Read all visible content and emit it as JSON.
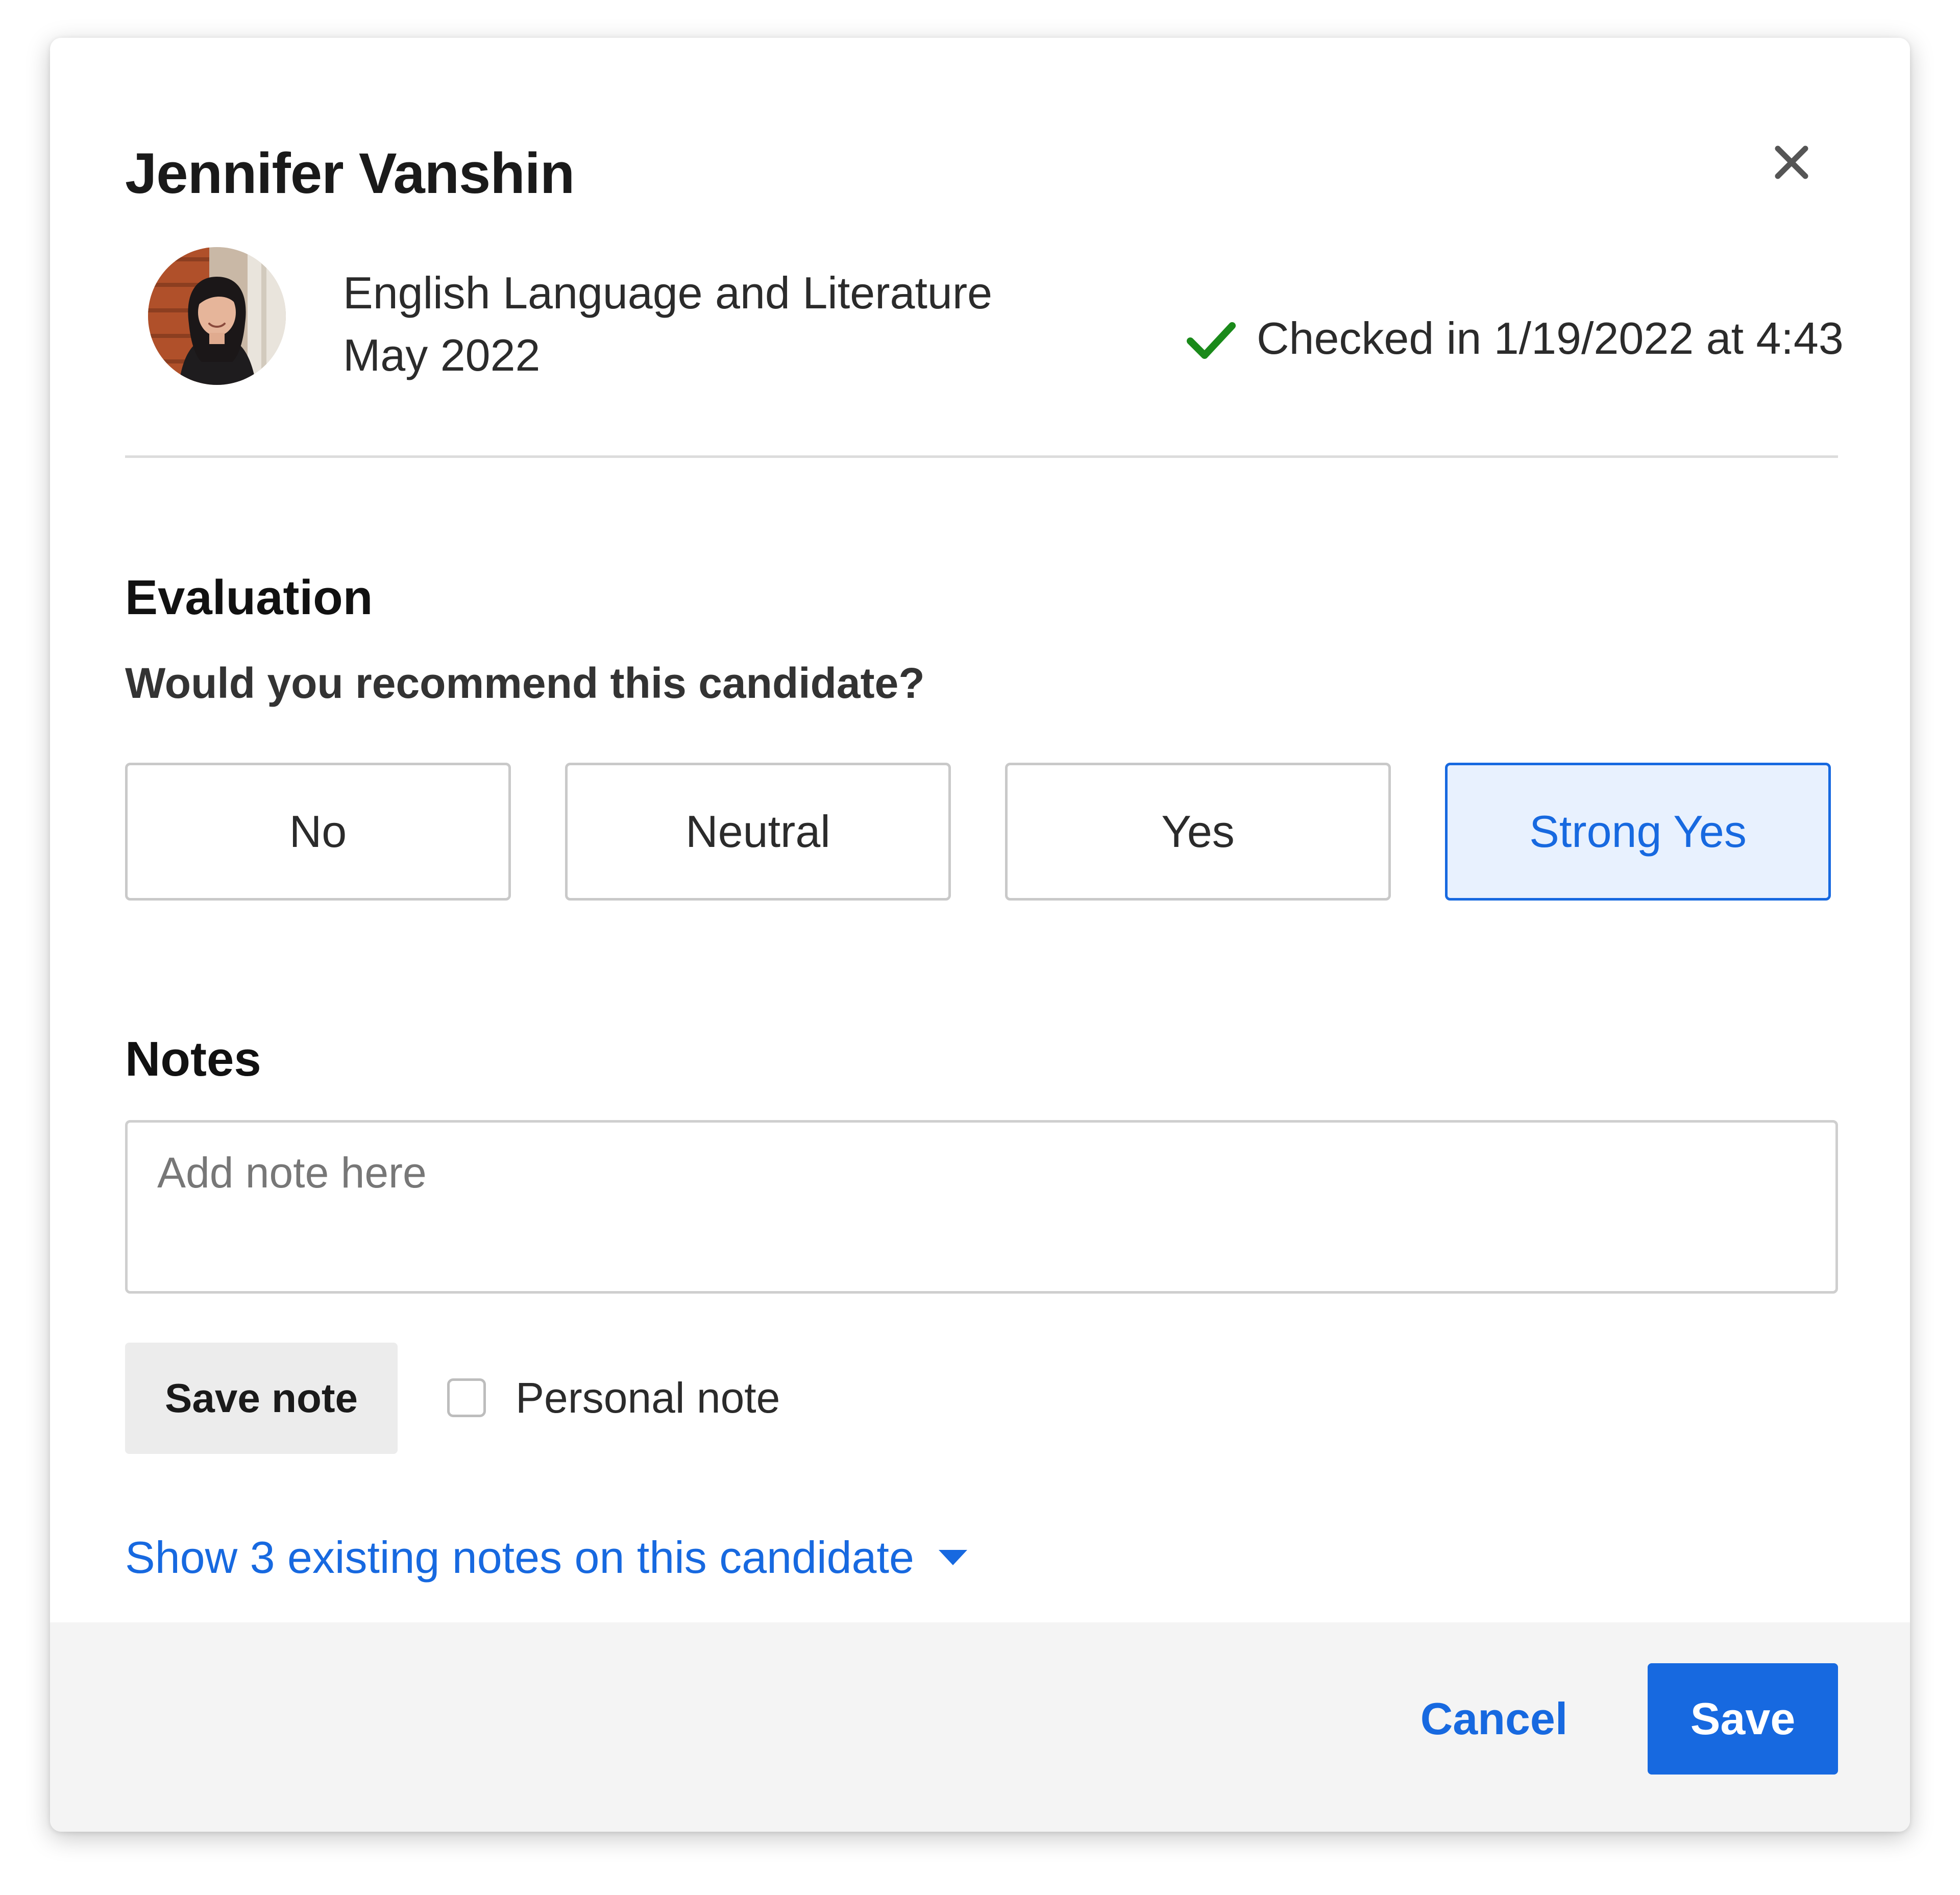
{
  "modal": {
    "title": "Jennifer Vanshin",
    "close_icon": "close-icon"
  },
  "candidate": {
    "program": "English Language and Literature",
    "term": "May 2022",
    "checkin_text": "Checked in 1/19/2022 at 4:43",
    "checkin_icon": "checkmark-icon",
    "checkin_color": "#1a8a1a"
  },
  "evaluation": {
    "heading": "Evaluation",
    "question": "Would you recommend this candidate?",
    "options": [
      {
        "label": "No",
        "selected": false
      },
      {
        "label": "Neutral",
        "selected": false
      },
      {
        "label": "Yes",
        "selected": false
      },
      {
        "label": "Strong Yes",
        "selected": true
      }
    ]
  },
  "notes": {
    "heading": "Notes",
    "placeholder": "Add note here",
    "value": "",
    "save_note_label": "Save note",
    "personal_note_label": "Personal note",
    "personal_note_checked": false,
    "show_existing_label": "Show 3 existing notes on this candidate",
    "show_existing_icon": "caret-down-icon"
  },
  "footer": {
    "cancel_label": "Cancel",
    "save_label": "Save"
  },
  "colors": {
    "accent": "#1769e0",
    "selected_bg": "#e8f1fe",
    "footer_bg": "#f4f4f4"
  }
}
